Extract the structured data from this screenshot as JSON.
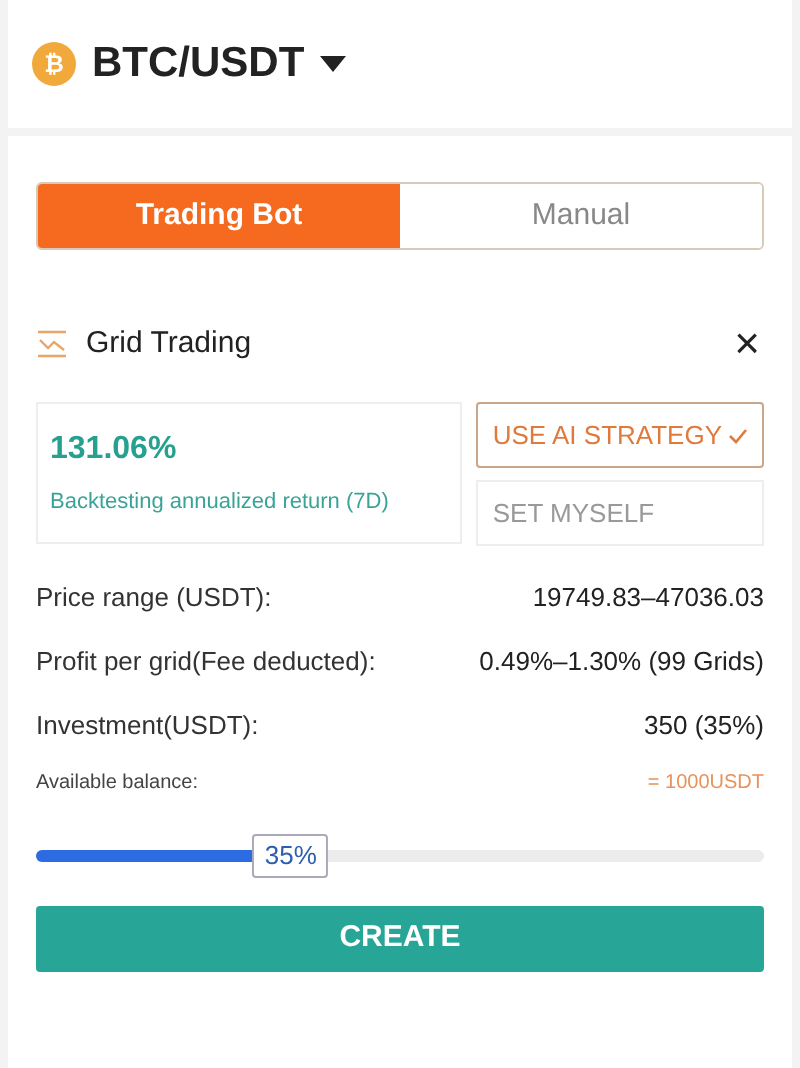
{
  "pair": {
    "symbol": "BTC/USDT",
    "coin_glyph": "₿"
  },
  "tabs": [
    {
      "label": "Trading Bot",
      "selected": true
    },
    {
      "label": "Manual",
      "selected": false
    }
  ],
  "strategy": {
    "title": "Grid Trading",
    "close": "×"
  },
  "backtest": {
    "value": "131.06%",
    "caption": "Backtesting annualized return (7D)"
  },
  "modes": [
    {
      "label": "USE AI STRATEGY",
      "selected": true
    },
    {
      "label": "SET MYSELF",
      "selected": false
    }
  ],
  "details": [
    {
      "label": "Price range (USDT):",
      "value": "19749.83–47036.03",
      "kind": "normal"
    },
    {
      "label": "Profit per grid(Fee deducted):",
      "value": "0.49%–1.30% (99 Grids)",
      "kind": "normal"
    },
    {
      "label": "Investment(USDT):",
      "value": "350 (35%)",
      "kind": "normal"
    },
    {
      "label": "Available balance:",
      "value": "= 1000USDT",
      "kind": "small"
    }
  ],
  "slider": {
    "level": 0.35,
    "reading": "35%"
  },
  "create_button": "CREATE"
}
